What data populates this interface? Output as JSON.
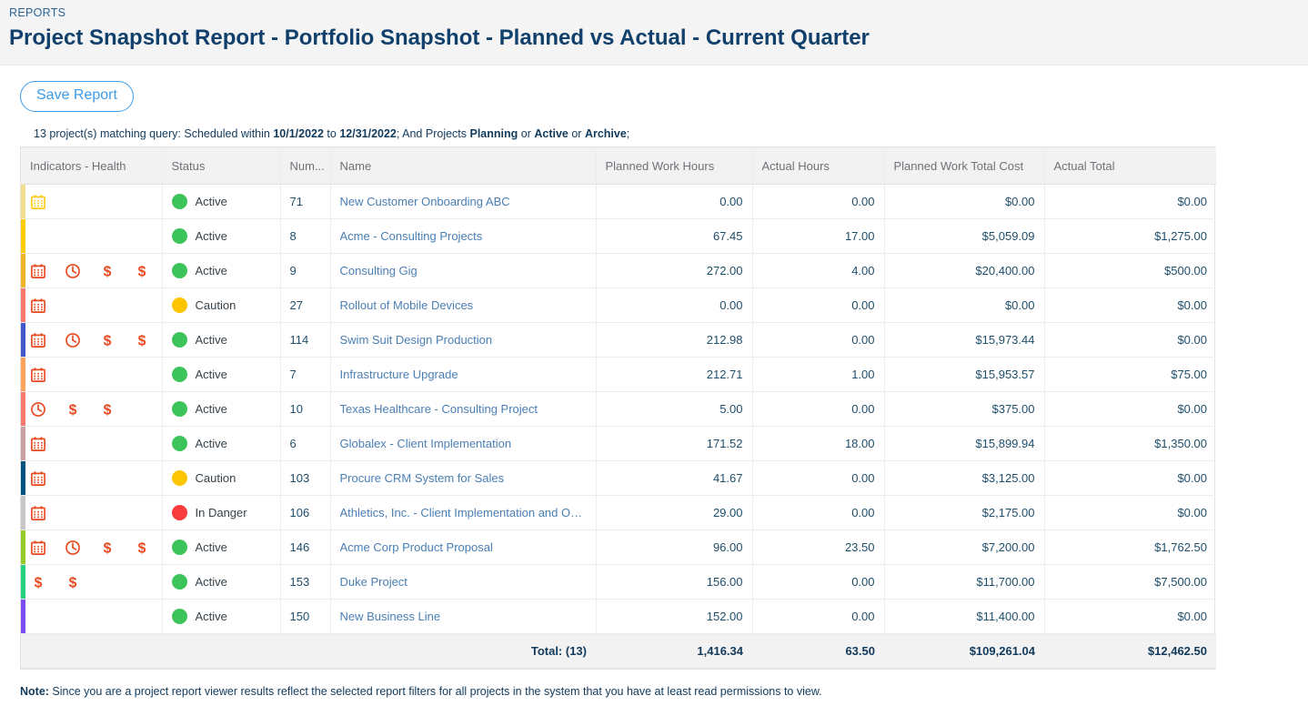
{
  "header": {
    "breadcrumb": "REPORTS",
    "title": "Project Snapshot Report - Portfolio Snapshot - Planned vs Actual - Current Quarter"
  },
  "toolbar": {
    "save_label": "Save Report"
  },
  "query": {
    "prefix": "13 project(s) matching query: Scheduled within ",
    "date_from": "10/1/2022",
    "mid1": " to ",
    "date_to": "12/31/2022",
    "mid2": "; And Projects ",
    "state1": "Planning",
    "or1": " or ",
    "state2": "Active",
    "or2": " or ",
    "state3": "Archive",
    "suffix": ";"
  },
  "table": {
    "columns": [
      "Indicators - Health",
      "Status",
      "Num...",
      "Name",
      "Planned Work Hours",
      "Actual Hours",
      "Planned Work Total Cost",
      "Actual Total"
    ],
    "rows": [
      {
        "health_color": "#f3dd8f",
        "indicators": [
          {
            "icon": "calendar-icon",
            "color": "#fdcc1c"
          }
        ],
        "status": "Active",
        "status_color": "#3cc45b",
        "number": "71",
        "name": "New Customer Onboarding ABC",
        "planned_hours": "0.00",
        "actual_hours": "0.00",
        "planned_cost": "$0.00",
        "actual_total": "$0.00"
      },
      {
        "health_color": "#fdcc00",
        "indicators": [],
        "status": "Active",
        "status_color": "#3cc45b",
        "number": "8",
        "name": "Acme - Consulting Projects",
        "planned_hours": "67.45",
        "actual_hours": "17.00",
        "planned_cost": "$5,059.09",
        "actual_total": "$1,275.00"
      },
      {
        "health_color": "#f0b429",
        "indicators": [
          {
            "icon": "calendar-icon",
            "color": "#e8491f"
          },
          {
            "icon": "clock-icon",
            "color": "#e8491f"
          },
          {
            "icon": "dollar-icon",
            "color": "#e8491f"
          },
          {
            "icon": "dollar-icon",
            "color": "#e8491f"
          }
        ],
        "status": "Active",
        "status_color": "#3cc45b",
        "number": "9",
        "name": "Consulting Gig",
        "planned_hours": "272.00",
        "actual_hours": "4.00",
        "planned_cost": "$20,400.00",
        "actual_total": "$500.00"
      },
      {
        "health_color": "#fa7a72",
        "indicators": [
          {
            "icon": "calendar-icon",
            "color": "#e8491f"
          }
        ],
        "status": "Caution",
        "status_color": "#fdc400",
        "number": "27",
        "name": "Rollout of Mobile Devices",
        "planned_hours": "0.00",
        "actual_hours": "0.00",
        "planned_cost": "$0.00",
        "actual_total": "$0.00"
      },
      {
        "health_color": "#4257c8",
        "indicators": [
          {
            "icon": "calendar-icon",
            "color": "#e8491f"
          },
          {
            "icon": "clock-icon",
            "color": "#e8491f"
          },
          {
            "icon": "dollar-icon",
            "color": "#e8491f"
          },
          {
            "icon": "dollar-icon",
            "color": "#e8491f"
          }
        ],
        "status": "Active",
        "status_color": "#3cc45b",
        "number": "114",
        "name": "Swim Suit Design Production",
        "planned_hours": "212.98",
        "actual_hours": "0.00",
        "planned_cost": "$15,973.44",
        "actual_total": "$0.00"
      },
      {
        "health_color": "#ffa35b",
        "indicators": [
          {
            "icon": "calendar-icon",
            "color": "#e8491f"
          }
        ],
        "status": "Active",
        "status_color": "#3cc45b",
        "number": "7",
        "name": "Infrastructure Upgrade",
        "planned_hours": "212.71",
        "actual_hours": "1.00",
        "planned_cost": "$15,953.57",
        "actual_total": "$75.00"
      },
      {
        "health_color": "#fa7a72",
        "indicators": [
          {
            "icon": "clock-icon",
            "color": "#e8491f"
          },
          {
            "icon": "dollar-icon",
            "color": "#e8491f"
          },
          {
            "icon": "dollar-icon",
            "color": "#e8491f"
          }
        ],
        "status": "Active",
        "status_color": "#3cc45b",
        "number": "10",
        "name": "Texas Healthcare - Consulting Project",
        "planned_hours": "5.00",
        "actual_hours": "0.00",
        "planned_cost": "$375.00",
        "actual_total": "$0.00"
      },
      {
        "health_color": "#c9a0a0",
        "indicators": [
          {
            "icon": "calendar-icon",
            "color": "#e8491f"
          }
        ],
        "status": "Active",
        "status_color": "#3cc45b",
        "number": "6",
        "name": "Globalex - Client Implementation",
        "planned_hours": "171.52",
        "actual_hours": "18.00",
        "planned_cost": "$15,899.94",
        "actual_total": "$1,350.00"
      },
      {
        "health_color": "#01527e",
        "indicators": [
          {
            "icon": "calendar-icon",
            "color": "#e8491f"
          }
        ],
        "status": "Caution",
        "status_color": "#fdc400",
        "number": "103",
        "name": "Procure CRM System for Sales",
        "planned_hours": "41.67",
        "actual_hours": "0.00",
        "planned_cost": "$3,125.00",
        "actual_total": "$0.00"
      },
      {
        "health_color": "#c7c7c7",
        "indicators": [
          {
            "icon": "calendar-icon",
            "color": "#e8491f"
          }
        ],
        "status": "In Danger",
        "status_color": "#f83b3b",
        "number": "106",
        "name": "Athletics, Inc. - Client Implementation and Onbo...",
        "planned_hours": "29.00",
        "actual_hours": "0.00",
        "planned_cost": "$2,175.00",
        "actual_total": "$0.00"
      },
      {
        "health_color": "#92cb2a",
        "indicators": [
          {
            "icon": "calendar-icon",
            "color": "#e8491f"
          },
          {
            "icon": "clock-icon",
            "color": "#e8491f"
          },
          {
            "icon": "dollar-icon",
            "color": "#e8491f"
          },
          {
            "icon": "dollar-icon",
            "color": "#e8491f"
          }
        ],
        "status": "Active",
        "status_color": "#3cc45b",
        "number": "146",
        "name": "Acme Corp Product Proposal",
        "planned_hours": "96.00",
        "actual_hours": "23.50",
        "planned_cost": "$7,200.00",
        "actual_total": "$1,762.50"
      },
      {
        "health_color": "#24d17e",
        "indicators": [
          {
            "icon": "dollar-icon",
            "color": "#e8491f"
          },
          {
            "icon": "dollar-icon",
            "color": "#e8491f"
          }
        ],
        "status": "Active",
        "status_color": "#3cc45b",
        "number": "153",
        "name": "Duke Project",
        "planned_hours": "156.00",
        "actual_hours": "0.00",
        "planned_cost": "$11,700.00",
        "actual_total": "$7,500.00"
      },
      {
        "health_color": "#7a4df5",
        "indicators": [],
        "status": "Active",
        "status_color": "#3cc45b",
        "number": "150",
        "name": "New Business Line",
        "planned_hours": "152.00",
        "actual_hours": "0.00",
        "planned_cost": "$11,400.00",
        "actual_total": "$0.00"
      }
    ],
    "totals": {
      "label": "Total: (13)",
      "planned_hours": "1,416.34",
      "actual_hours": "63.50",
      "planned_cost": "$109,261.04",
      "actual_total": "$12,462.50"
    }
  },
  "footer": {
    "note_prefix": "Note:",
    "note_text": " Since you are a project report viewer results reflect the selected report filters for all projects in the system that you have at least read permissions to view."
  },
  "colors": {
    "title": "#10406b",
    "link": "#4a7fb5",
    "accent": "#3d9be9",
    "indicator": "#e8491f"
  }
}
